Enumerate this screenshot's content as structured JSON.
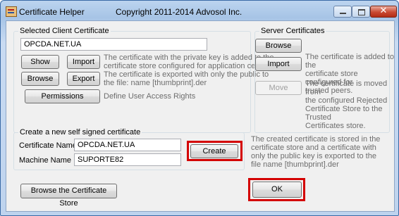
{
  "window": {
    "title": "Certificate Helper",
    "copyright": "Copyright 2011-2014 Advosol Inc.",
    "close_glyph": "✕"
  },
  "client_group": {
    "label": "Selected Client Certificate",
    "selected_cert": "OPCDA.NET.UA",
    "show": "Show",
    "import": "Import",
    "browse": "Browse",
    "export": "Export",
    "permissions": "Permissions",
    "import_desc": [
      "The certificate with the private key is added to the",
      "certificate store configured for application certs."
    ],
    "export_desc": [
      "The certificate is exported with only the public to",
      "the file:   name [thumbprint].der"
    ],
    "permissions_desc": "Define User Access Rights"
  },
  "server_group": {
    "label": "Server Certificates",
    "browse": "Browse",
    "import": "Import",
    "move": "Move",
    "import_desc": [
      "The certificate is added to the",
      "certificate store configured for",
      "trusted peers."
    ],
    "move_desc": [
      "The certificate is moved from",
      "the configured Rejected",
      "Certificate Store to the Trusted",
      "Certificates store."
    ]
  },
  "create_group": {
    "label": "Create a new self signed certificate",
    "cert_name_label": "Certificate Name",
    "cert_name_value": "OPCDA.NET.UA",
    "machine_name_label": "Machine Name",
    "machine_name_value": "SUPORTE82",
    "create": "Create",
    "create_desc": [
      "The created certificate is stored in the",
      "certificate store and a certificate with",
      "only the public key is exported to the",
      "file  name [thumbprint].der"
    ]
  },
  "footer": {
    "browse_store": "Browse the Certificate Store",
    "ok": "OK"
  },
  "colors": {
    "highlight": "#d40000",
    "titlebar": "#a7c4e6",
    "close_button": "#c94a33"
  }
}
